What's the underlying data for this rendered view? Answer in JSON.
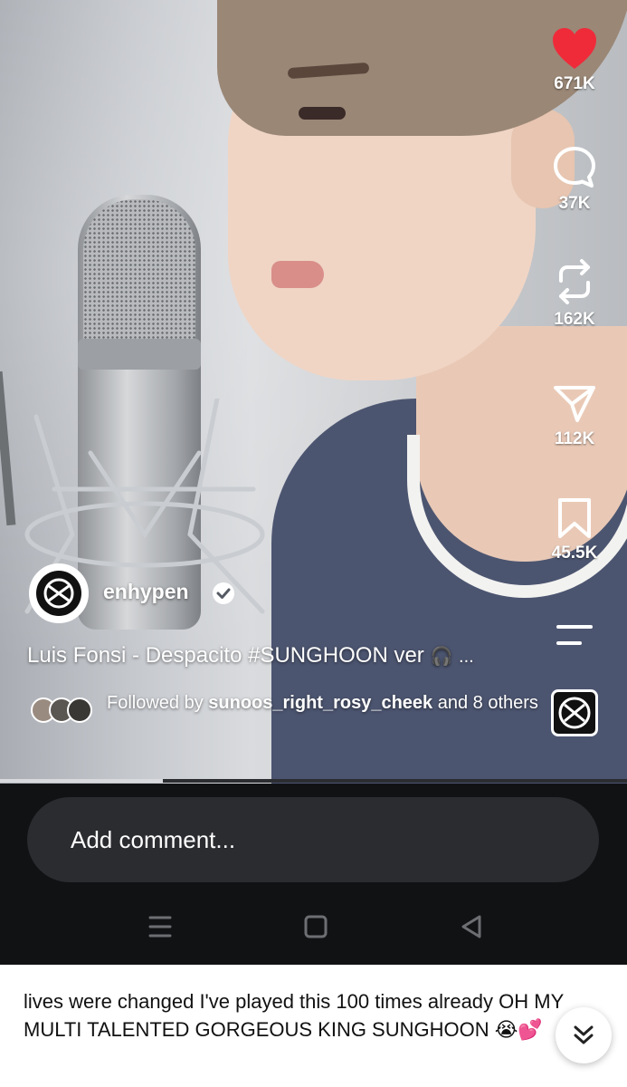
{
  "video": {
    "progress": 0.26,
    "author": {
      "handle": "enhypen",
      "verified": true
    },
    "caption": "Luis Fonsi - Despacito #SUNGHOON ver",
    "caption_more": "...",
    "followed_by": {
      "prefix": "Followed by",
      "user": "sunoos_right_rosy_cheek",
      "suffix": "and 8 others"
    },
    "actions": [
      {
        "name": "like",
        "icon": "heart-icon",
        "count": "671K",
        "active_color": "#ef2b3a"
      },
      {
        "name": "comment",
        "icon": "comment-icon",
        "count": "37K"
      },
      {
        "name": "repost",
        "icon": "repost-icon",
        "count": "162K"
      },
      {
        "name": "share",
        "icon": "send-icon",
        "count": "112K"
      },
      {
        "name": "save",
        "icon": "bookmark-icon",
        "count": "45.5K"
      },
      {
        "name": "more",
        "icon": "menu-icon"
      },
      {
        "name": "audio",
        "icon": "audio-thumbnail"
      }
    ]
  },
  "comment_bar": {
    "placeholder": "Add comment..."
  },
  "system_nav": [
    {
      "name": "recents",
      "icon": "menu-lines-icon"
    },
    {
      "name": "home",
      "icon": "square-icon"
    },
    {
      "name": "back",
      "icon": "triangle-back-icon"
    }
  ],
  "tweet": {
    "text": "lives were changed I've played this 100 times already OH MY MULTI TALENTED GORGEOUS KING SUNGHOON 😭💕",
    "expand_icon": "double-chevron-down-icon"
  }
}
